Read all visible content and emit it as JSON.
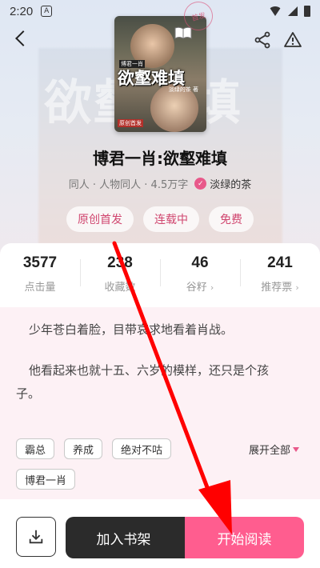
{
  "status_bar": {
    "time": "2:20",
    "app_icon": "A"
  },
  "nav": {
    "back_icon": "back-arrow-icon",
    "share_icon": "share-icon",
    "report_icon": "warning-icon"
  },
  "cover": {
    "title": "欲壑难填",
    "tag": "博君一肖",
    "author": "淡绿的茶 著",
    "badge": "原创首发",
    "stamp": "首发"
  },
  "book": {
    "title": "博君一肖:欲壑难填",
    "meta": "同人 · 人物同人 · 4.5万字",
    "author_badge": "✓",
    "author": "淡绿的茶"
  },
  "badges": [
    "原创首发",
    "连载中",
    "免费"
  ],
  "stats": [
    {
      "value": "3577",
      "label": "点击量",
      "chevron": ""
    },
    {
      "value": "238",
      "label": "收藏数",
      "chevron": ""
    },
    {
      "value": "46",
      "label": "谷籽",
      "chevron": "›"
    },
    {
      "value": "241",
      "label": "推荐票",
      "chevron": "›"
    }
  ],
  "description": {
    "paragraph1": "少年苍白着脸，目带哀求地看着肖战。",
    "paragraph2a": "他看起来也就十五、六岁的模样，还只是个孩",
    "paragraph2b": "子。"
  },
  "tags": [
    "霸总",
    "养成",
    "绝对不咕",
    "博君一肖"
  ],
  "expand_label": "展开全部",
  "bottom": {
    "download_icon": "download-icon",
    "shelf_label": "加入书架",
    "read_label": "开始阅读"
  },
  "colors": {
    "accent": "#ff5d8f",
    "tag_text": "#d0466f",
    "annotation": "#ff0000"
  }
}
